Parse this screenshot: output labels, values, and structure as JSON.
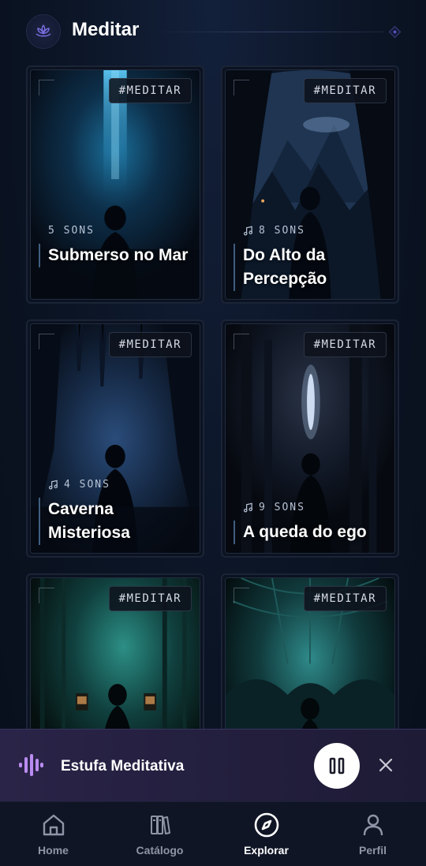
{
  "header": {
    "title": "Meditar",
    "logo_icon": "lotus-icon"
  },
  "cards": [
    {
      "tag": "#MEDITAR",
      "count": "5 SONS",
      "show_note_icon": false,
      "title": "Submerso no Mar"
    },
    {
      "tag": "#MEDITAR",
      "count": "8 SONS",
      "show_note_icon": true,
      "title": "Do Alto da Percepção"
    },
    {
      "tag": "#MEDITAR",
      "count": "4 SONS",
      "show_note_icon": true,
      "title": "Caverna Misteriosa"
    },
    {
      "tag": "#MEDITAR",
      "count": "9 SONS",
      "show_note_icon": true,
      "title": "A queda do ego"
    },
    {
      "tag": "#MEDITAR"
    },
    {
      "tag": "#MEDITAR"
    }
  ],
  "player": {
    "title": "Estufa Meditativa",
    "state_icon": "pause-icon",
    "close_icon": "close-icon",
    "wave_icon": "audio-wave-icon",
    "accent": "#b98cf0"
  },
  "nav": {
    "items": [
      {
        "label": "Home",
        "icon": "home-icon",
        "active": false
      },
      {
        "label": "Catálogo",
        "icon": "books-icon",
        "active": false
      },
      {
        "label": "Explorar",
        "icon": "compass-icon",
        "active": true
      },
      {
        "label": "Perfil",
        "icon": "user-icon",
        "active": false
      }
    ]
  },
  "colors": {
    "background": "#0b1424",
    "player_bg": "#241f40",
    "nav_bg": "#101526",
    "nav_inactive": "#8f95a6",
    "nav_active": "#ffffff"
  }
}
